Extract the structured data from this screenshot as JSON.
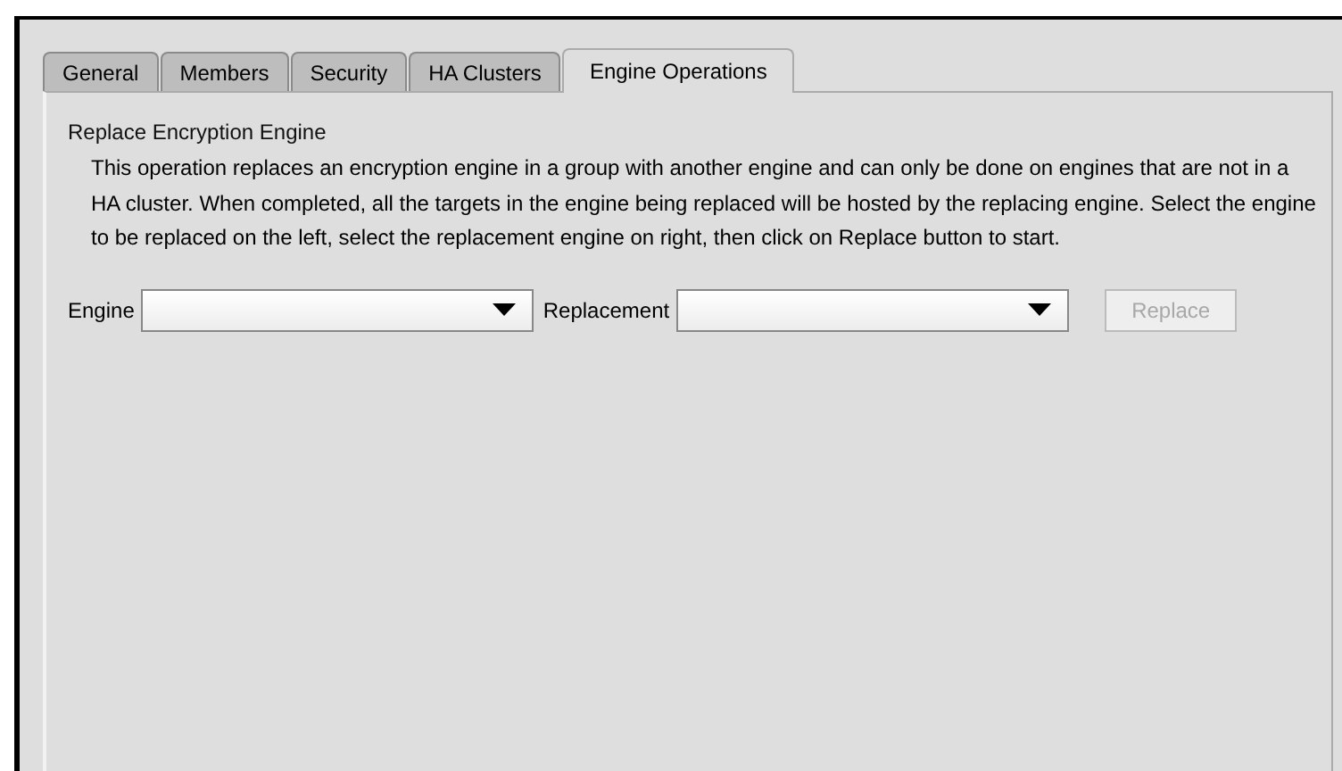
{
  "tabs": [
    {
      "label": "General",
      "selected": false
    },
    {
      "label": "Members",
      "selected": false
    },
    {
      "label": "Security",
      "selected": false
    },
    {
      "label": "HA Clusters",
      "selected": false
    },
    {
      "label": "Engine Operations",
      "selected": true
    }
  ],
  "section": {
    "title": "Replace Encryption Engine",
    "description": "This operation replaces an encryption engine in a group with another engine and can only be done on engines that are not in a HA cluster. When completed, all the targets in the engine being replaced will be hosted by the replacing engine. Select the engine to be replaced on the left, select the replacement engine on right, then click on Replace button to start."
  },
  "engine_field": {
    "label": "Engine"
  },
  "replacement_field": {
    "label": "Replacement"
  },
  "replace_button": {
    "label": "Replace",
    "disabled": true
  }
}
